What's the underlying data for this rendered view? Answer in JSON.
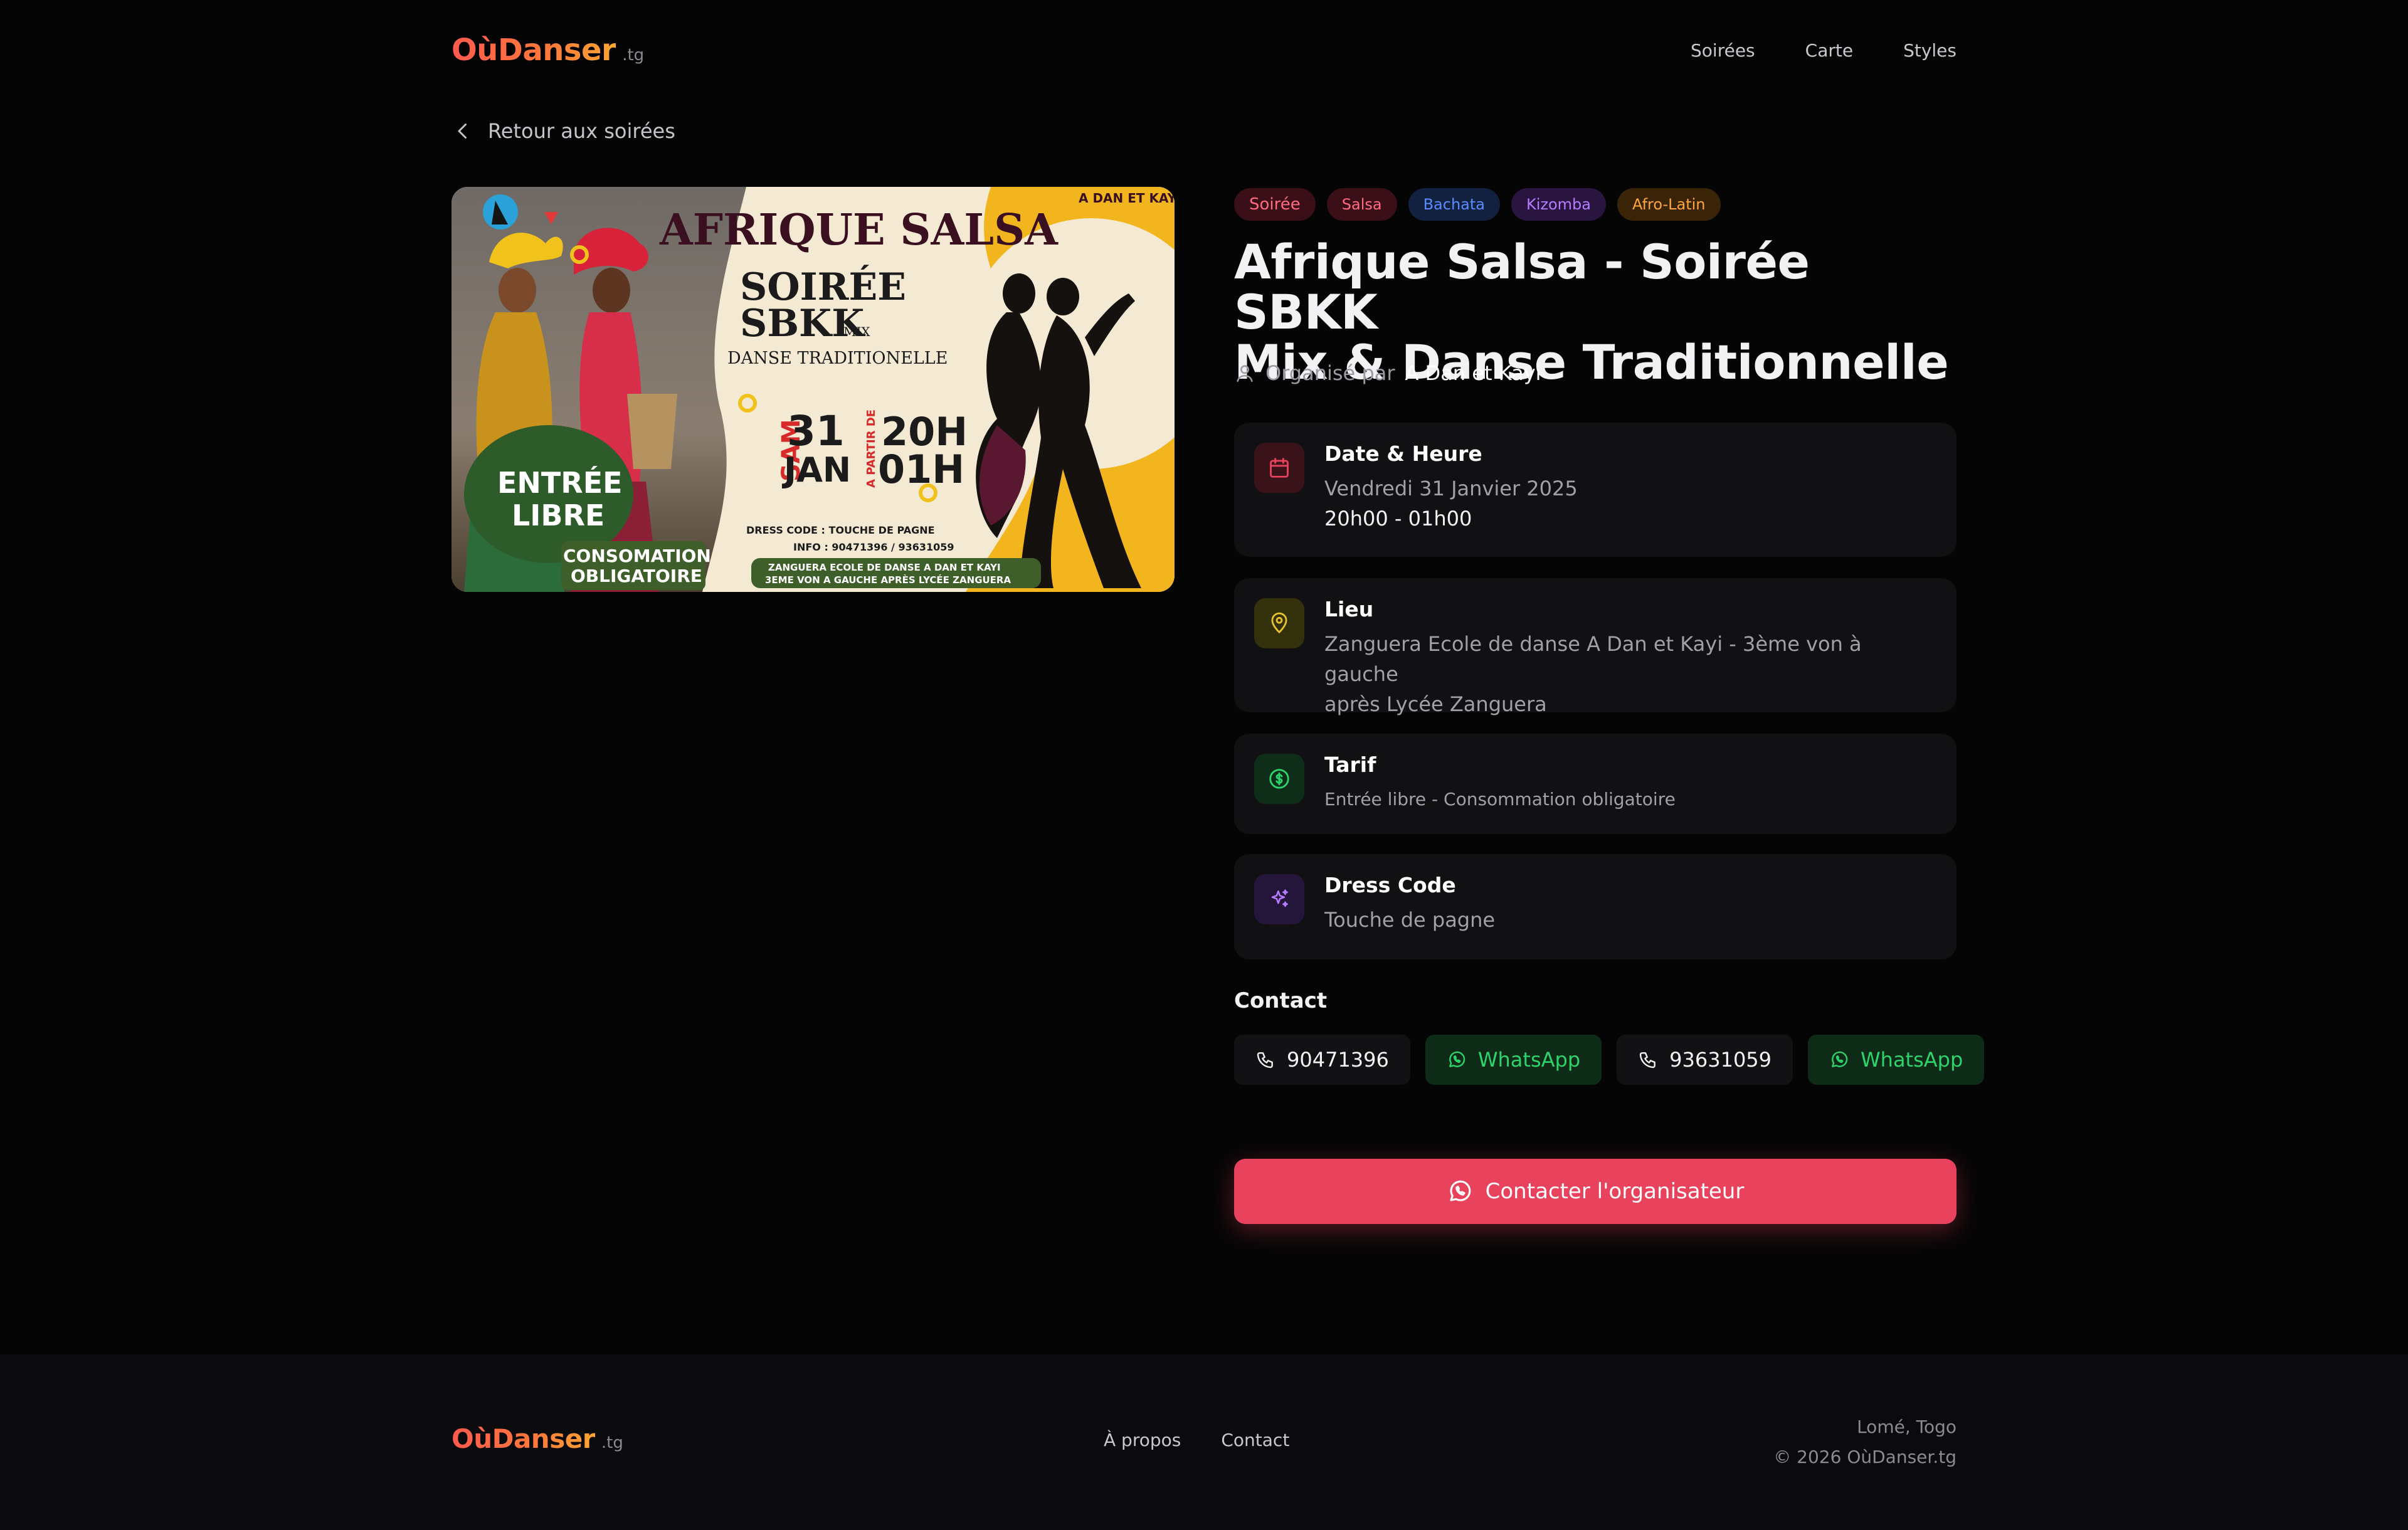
{
  "header": {
    "logo_main": "OùDanser",
    "logo_tld": ".tg",
    "nav": [
      "Soirées",
      "Carte",
      "Styles"
    ]
  },
  "back_link": "Retour aux soirées",
  "flyer": {
    "title": "AFRIQUE SALSA",
    "corner_text": "A DAN ET KAYI",
    "line1": "SOIRÉE",
    "line2": "SBKK",
    "line2_suffix": "MIX",
    "line3": "DANSE TRADITIONELLE",
    "day": "SAM",
    "date_num": "31",
    "date_month": "JAN",
    "from_label": "A PARTIR DE",
    "time_start": "20H",
    "time_end": "01H",
    "entry_1": "ENTRÉE",
    "entry_2": "LIBRE",
    "conso_1": "CONSOMATION",
    "conso_2": "OBLIGATOIRE",
    "dress": "DRESS CODE : TOUCHE DE PAGNE",
    "info": "INFO : 90471396 / 93631059",
    "address_1": "ZANGUERA ECOLE DE DANSE A DAN ET KAYI",
    "address_2": "3EME VON A GAUCHE APRÈS LYCÉE ZANGUERA"
  },
  "tags": [
    {
      "label": "Soirée",
      "bg": "#3a0f17",
      "fg": "#ff6b7f"
    },
    {
      "label": "Salsa",
      "bg": "#3a0f17",
      "fg": "#ff6b7f"
    },
    {
      "label": "Bachata",
      "bg": "#12213f",
      "fg": "#5b8cff"
    },
    {
      "label": "Kizomba",
      "bg": "#2a1540",
      "fg": "#b67cff"
    },
    {
      "label": "Afro-Latin",
      "bg": "#3a2408",
      "fg": "#ffa53a"
    }
  ],
  "title_line1": "Afrique Salsa - Soirée SBKK",
  "title_line2": "Mix & Danse Traditionnelle",
  "organizer_label": "Organisé par",
  "organizer_name": "A Dan et Kayi",
  "cards": {
    "date": {
      "title": "Date & Heure",
      "line1": "Vendredi 31 Janvier 2025",
      "line2": "20h00 - 01h00"
    },
    "place": {
      "title": "Lieu",
      "line1": "Zanguera Ecole de danse A Dan et Kayi - 3ème von à gauche",
      "line2": "après Lycée Zanguera"
    },
    "price": {
      "title": "Tarif",
      "line1": "Entrée libre - Consommation obligatoire"
    },
    "dress": {
      "title": "Dress Code",
      "line1": "Touche de pagne"
    }
  },
  "contact": {
    "heading": "Contact",
    "phone1": "90471396",
    "whatsapp1": "WhatsApp",
    "phone2": "93631059",
    "whatsapp2": "WhatsApp"
  },
  "cta_label": "Contacter l'organisateur",
  "footer": {
    "logo_main": "OùDanser",
    "logo_tld": ".tg",
    "links": [
      "À propos",
      "Contact"
    ],
    "location": "Lomé, Togo",
    "copyright": "© 2026 OùDanser.tg"
  },
  "colors": {
    "accent": "#e8425c",
    "background": "#050505",
    "card": "#111113",
    "whatsapp_green": "#2ed36b"
  }
}
